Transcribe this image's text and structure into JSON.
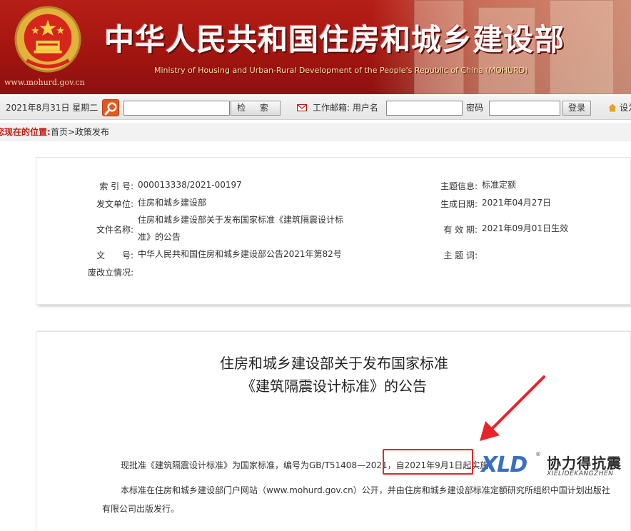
{
  "header": {
    "site_title": "中华人民共和国住房和城乡建设部",
    "site_subtitle": "Ministry of Housing and Urban-Rural Development of the People's Republic of China (MOHURD)",
    "site_url": "www.mohurd.gov.cn"
  },
  "toolbar": {
    "date": "2021年8月31日 星期二",
    "search_placeholder": "",
    "search_button": "检 索",
    "mail_label": "工作邮箱: 用户名",
    "password_label": "密码",
    "login_button": "登录",
    "home_label": "设为"
  },
  "breadcrumb": {
    "label": "您现在的位置:",
    "path": "首页>政策发布"
  },
  "info": {
    "index_no_label": "索 引 号:",
    "index_no": "000013338/2021-00197",
    "issuer_label": "发文单位:",
    "issuer": "住房和城乡建设部",
    "file_name_label": "文件名称:",
    "file_name_line1": "住房和城乡建设部关于发布国家标准《建筑隔震设计标",
    "file_name_line2": "准》的公告",
    "doc_no_label": "文　　号:",
    "doc_no": "中华人民共和国住房和城乡建设部公告2021年第82号",
    "status_label": "废改立情况:",
    "status": "",
    "topic_label": "主题信息:",
    "topic": "标准定额",
    "created_label": "生成日期:",
    "created": "2021年04月27日",
    "validity_label": "有 效 期:",
    "validity": "2021年09月01日生效",
    "keywords_label": "主 题 词:",
    "keywords": ""
  },
  "article": {
    "title_line1": "住房和城乡建设部关于发布国家标准",
    "title_line2": "《建筑隔震设计标准》的公告",
    "para1_a": "现批准《建筑隔震设计标准》为国家标准，编号为GB/T51408—2021，",
    "para1_b": "自2021年9月1日起实施",
    "para1_c": "。",
    "para2_line1": "本标准在住房和城乡建设部门户网站（www.mohurd.gov.cn）公开，并由住房和城乡建设部标准定额研究所组织中国计划出版社",
    "para2_line2": "有限公司出版发行。"
  },
  "watermark": {
    "logo": "XLD",
    "registered": "®",
    "name_cn": "协力得抗震",
    "name_en": "XIELIDEKANGZHEN"
  },
  "colors": {
    "banner_red": "#a3150f",
    "breadcrumb_red": "#c41a10",
    "highlight_red": "#e8242a",
    "watermark_blue": "#3a6ec5"
  },
  "icons": {
    "search": "search-icon",
    "mail": "mail-icon",
    "home": "home-icon",
    "emblem": "national-emblem-icon"
  }
}
